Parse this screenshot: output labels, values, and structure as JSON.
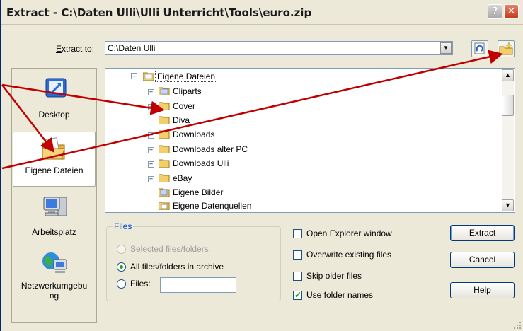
{
  "window": {
    "title": "Extract - C:\\Daten Ulli\\Ulli Unterricht\\Tools\\euro.zip",
    "help_glyph": "?",
    "close_glyph": "✕"
  },
  "extract_to": {
    "label": "Extract to:",
    "value": "C:\\Daten Ulli",
    "arrow_glyph": "▼"
  },
  "places": [
    {
      "label": "Desktop",
      "icon": "desktop-icon"
    },
    {
      "label": "Eigene Dateien",
      "icon": "my-documents-icon",
      "selected": true
    },
    {
      "label": "Arbeitsplatz",
      "icon": "my-computer-icon"
    },
    {
      "label_line1": "Netzwerkumgebu",
      "label_line2": "ng",
      "icon": "network-icon"
    }
  ],
  "tree": {
    "root": "Eigene Dateien",
    "items": [
      "Cliparts",
      "Cover",
      "Diva",
      "Downloads",
      "Downloads alter PC",
      "Downloads Ulli",
      "eBay",
      "Eigene Bilder",
      "Eigene Datenquellen"
    ],
    "scroll_up_glyph": "▲",
    "scroll_down_glyph": "▼"
  },
  "files_group": {
    "title": "Files",
    "selected_label": "Selected files/folders",
    "all_label": "All files/folders in archive",
    "files_label": "Files:",
    "files_value": ""
  },
  "options": {
    "open_explorer": "Open Explorer window",
    "overwrite": "Overwrite existing files",
    "skip_older": "Skip older files",
    "use_folder_names": "Use folder names",
    "use_folder_names_checked": true
  },
  "buttons": {
    "extract": "Extract",
    "cancel": "Cancel",
    "help": "Help"
  },
  "colors": {
    "arrow": "#c00000",
    "title_close": "#c43a18",
    "group_title": "#0046d5"
  }
}
